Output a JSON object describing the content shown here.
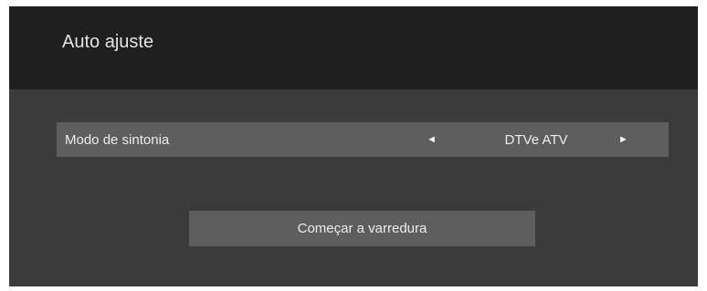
{
  "dialog": {
    "title": "Auto ajuste"
  },
  "tuning_mode": {
    "label": "Modo de sintonia",
    "value": "DTVe ATV",
    "left_arrow": "◄",
    "right_arrow": "►"
  },
  "actions": {
    "start_scan_label": "Começar a varredura"
  },
  "colors": {
    "header_bg": "#1f1f1f",
    "body_bg": "#3b3b3b",
    "item_bg": "#5e5e5e",
    "text": "#ececec"
  }
}
